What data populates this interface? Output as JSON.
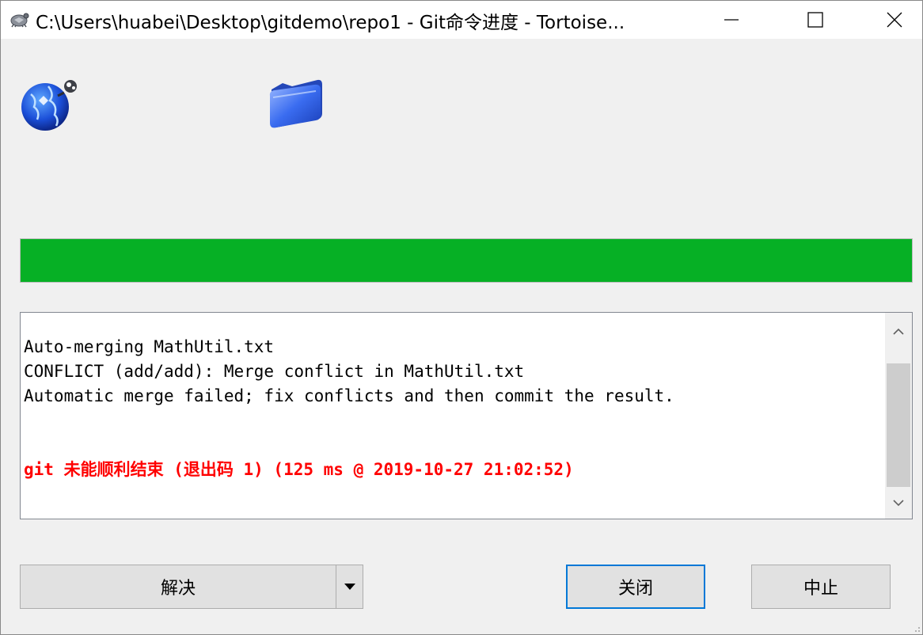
{
  "window": {
    "title": "C:\\Users\\huabei\\Desktop\\gitdemo\\repo1 - Git命令进度 - Tortoise...",
    "icon": "tortoisegit-app-icon"
  },
  "window_controls": {
    "minimize_icon": "minimize-icon",
    "maximize_icon": "maximize-icon",
    "close_icon": "close-icon"
  },
  "status_icons": {
    "remote": "globe-icon",
    "local": "folder-icon"
  },
  "progress": {
    "fraction": 1.0,
    "color": "#06b025"
  },
  "log": {
    "lines": [
      "Auto-merging MathUtil.txt",
      "CONFLICT (add/add): Merge conflict in MathUtil.txt",
      "Automatic merge failed; fix conflicts and then commit the result.",
      "",
      "",
      "git 未能顺利结束 (退出码 1) (125 ms @ 2019-10-27 21:02:52)"
    ],
    "error_color": "#ff0000"
  },
  "buttons": {
    "resolve": "解决",
    "close": "关闭",
    "abort": "中止"
  }
}
